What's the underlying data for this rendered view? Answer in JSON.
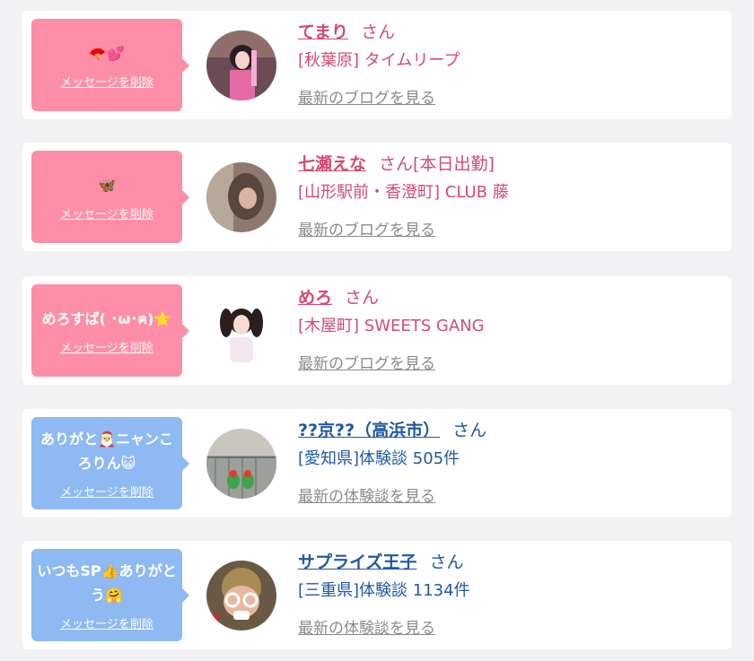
{
  "cards": [
    {
      "message": "🪭💕",
      "delete_label": "メッセージを削除",
      "name": "てまり",
      "honorific": "さん",
      "extra": "",
      "shop": "[秋葉原] タイムリープ",
      "link": "最新のブログを見る",
      "theme": "pink"
    },
    {
      "message": "🦋",
      "delete_label": "メッセージを削除",
      "name": "七瀬えな",
      "honorific": "さん",
      "extra": "[本日出勤]",
      "shop": "[山形駅前・香澄町] CLUB 藤",
      "link": "最新のブログを見る",
      "theme": "pink"
    },
    {
      "message": "めろすば( ･ω･ฅ)⭐️",
      "delete_label": "メッセージを削除",
      "name": "めろ",
      "honorific": "さん",
      "extra": "",
      "shop": "[木屋町] SWEETS GANG",
      "link": "最新のブログを見る",
      "theme": "pink"
    },
    {
      "message": "ありがと🎅ニャンころりん😺",
      "delete_label": "メッセージを削除",
      "name": "??京??（高浜市）",
      "honorific": "さん",
      "extra": "",
      "shop": "[愛知県]体験談 505件",
      "link": "最新の体験談を見る",
      "theme": "blue"
    },
    {
      "message": "いつもSP👍ありがとう🤗",
      "delete_label": "メッセージを削除",
      "name": "サプライズ王子",
      "honorific": "さん",
      "extra": "",
      "shop": "[三重県]体験談 1134件",
      "link": "最新の体験談を見る",
      "theme": "blue"
    }
  ]
}
